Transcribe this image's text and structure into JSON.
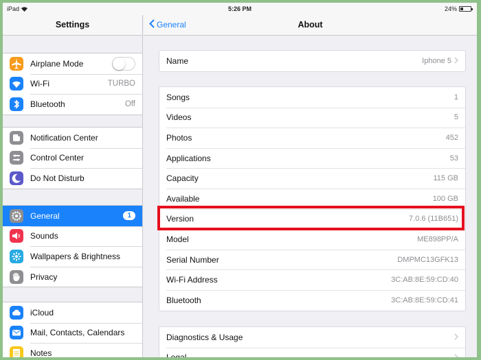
{
  "status": {
    "device": "iPad",
    "time": "5:26 PM",
    "battery": "24%",
    "battery_level": 0.24
  },
  "left": {
    "title": "Settings",
    "groups": [
      [
        {
          "label": "Airplane Mode",
          "icon": "airplane-icon",
          "color": "#f89b1c",
          "type": "toggle"
        },
        {
          "label": "Wi-Fi",
          "icon": "wifi-icon",
          "color": "#1a82fb",
          "value": "TURBO"
        },
        {
          "label": "Bluetooth",
          "icon": "bluetooth-icon",
          "color": "#1a82fb",
          "value": "Off"
        }
      ],
      [
        {
          "label": "Notification Center",
          "icon": "notification-icon",
          "color": "#8e8e93"
        },
        {
          "label": "Control Center",
          "icon": "control-center-icon",
          "color": "#8e8e93"
        },
        {
          "label": "Do Not Disturb",
          "icon": "moon-icon",
          "color": "#5b59c9"
        }
      ],
      [
        {
          "label": "General",
          "icon": "gear-icon",
          "color": "#8e8e93",
          "badge": "1",
          "selected": true
        },
        {
          "label": "Sounds",
          "icon": "speaker-icon",
          "color": "#f0344f"
        },
        {
          "label": "Wallpapers & Brightness",
          "icon": "wallpaper-icon",
          "color": "#27aae1"
        },
        {
          "label": "Privacy",
          "icon": "hand-icon",
          "color": "#8e8e93"
        }
      ],
      [
        {
          "label": "iCloud",
          "icon": "cloud-icon",
          "color": "#1a82fb"
        },
        {
          "label": "Mail, Contacts, Calendars",
          "icon": "mail-icon",
          "color": "#1a82fb"
        },
        {
          "label": "Notes",
          "icon": "notes-icon",
          "color": "#f8c81c"
        }
      ]
    ]
  },
  "right": {
    "back_label": "General",
    "title": "About",
    "groups": [
      [
        {
          "label": "Name",
          "value": "Iphone 5",
          "chevron": true
        }
      ],
      [
        {
          "label": "Songs",
          "value": "1"
        },
        {
          "label": "Videos",
          "value": "5"
        },
        {
          "label": "Photos",
          "value": "452"
        },
        {
          "label": "Applications",
          "value": "53"
        },
        {
          "label": "Capacity",
          "value": "115 GB"
        },
        {
          "label": "Available",
          "value": "100 GB"
        },
        {
          "label": "Version",
          "value": "7.0.6 (11B651)"
        },
        {
          "label": "Model",
          "value": "ME898PP/A"
        },
        {
          "label": "Serial Number",
          "value": "DMPMC13GFK13"
        },
        {
          "label": "Wi-Fi Address",
          "value": "3C:AB:8E:59:CD:40"
        },
        {
          "label": "Bluetooth",
          "value": "3C:AB:8E:59:CD:41"
        }
      ],
      [
        {
          "label": "Diagnostics & Usage",
          "chevron": true
        },
        {
          "label": "Legal",
          "chevron": true
        }
      ]
    ]
  },
  "colors": {
    "accent": "#1a82fb",
    "highlight": "#e5101e"
  }
}
